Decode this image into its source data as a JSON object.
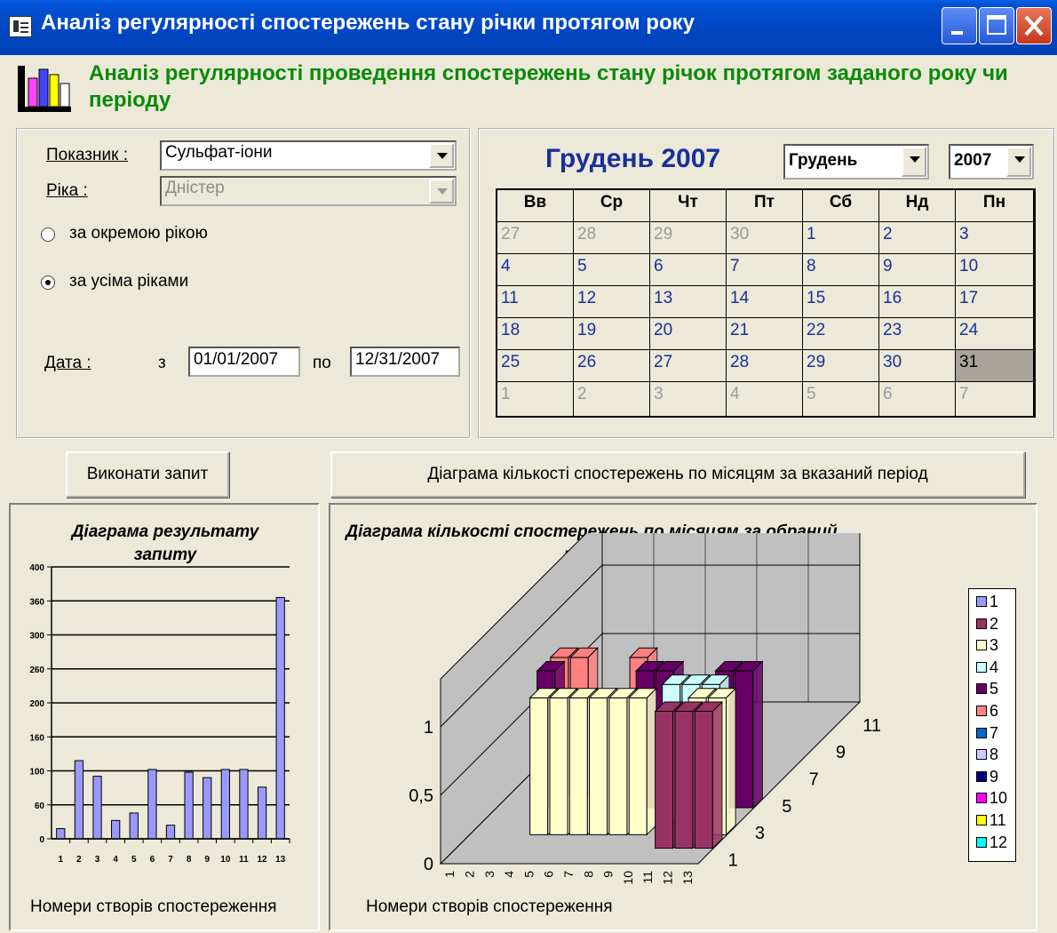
{
  "window": {
    "title": "Аналіз регулярності спостережень стану річки протягом року"
  },
  "header": {
    "text": "Аналіз регулярності проведення спостережень стану річок протягом заданого року чи періоду"
  },
  "filters": {
    "indicator_label": "Показник :",
    "indicator_value": "Сульфат-іони",
    "river_label": "Ріка :",
    "river_value": "Дністер",
    "radio_single": "за окремою рікою",
    "radio_all": "за усіма ріками",
    "radio_selected": "all",
    "date_label": "Дата :",
    "date_from_label": "з",
    "date_from": "01/01/2007",
    "date_to_label": "по",
    "date_to": "12/31/2007"
  },
  "calendar": {
    "title": "Грудень 2007",
    "month_value": "Грудень",
    "year_value": "2007",
    "weekdays": [
      "Вв",
      "Ср",
      "Чт",
      "Пт",
      "Сб",
      "Нд",
      "Пн"
    ],
    "weeks": [
      [
        "27",
        "28",
        "29",
        "30",
        "1",
        "2",
        "3"
      ],
      [
        "4",
        "5",
        "6",
        "7",
        "8",
        "9",
        "10"
      ],
      [
        "11",
        "12",
        "13",
        "14",
        "15",
        "16",
        "17"
      ],
      [
        "18",
        "19",
        "20",
        "21",
        "22",
        "23",
        "24"
      ],
      [
        "25",
        "26",
        "27",
        "28",
        "29",
        "30",
        "31"
      ],
      [
        "1",
        "2",
        "3",
        "4",
        "5",
        "6",
        "7"
      ]
    ],
    "selected_day": "31"
  },
  "buttons": {
    "run_query": "Виконати запит",
    "monthly_chart": "Діаграма кількості спостережень по місяцям за вказаний період"
  },
  "chart_data": [
    {
      "type": "bar",
      "title": "Діаграма результату запиту",
      "xlabel": "Номери створів спостереження",
      "ylabel": "",
      "categories": [
        "1",
        "2",
        "3",
        "4",
        "5",
        "6",
        "7",
        "8",
        "9",
        "10",
        "11",
        "12",
        "13"
      ],
      "values": [
        15,
        115,
        92,
        27,
        38,
        102,
        20,
        98,
        90,
        102,
        102,
        76,
        355
      ],
      "ylim": [
        0,
        400
      ],
      "yticks": [
        0,
        50,
        100,
        150,
        200,
        250,
        300,
        350,
        400
      ],
      "ytick_labels": [
        "0",
        "60",
        "100",
        "160",
        "200",
        "260",
        "300",
        "360",
        "400"
      ],
      "grid": true,
      "bar_color": "#9999ff"
    },
    {
      "type": "bar",
      "title": "Діаграма кількості спостережень по місяцям за обраний період",
      "xlabel": "Номери створів спостереження",
      "categories": [
        "1",
        "2",
        "3",
        "4",
        "5",
        "6",
        "7",
        "8",
        "9",
        "10",
        "11",
        "12",
        "13"
      ],
      "depth_labels": [
        "1",
        "3",
        "5",
        "7",
        "9",
        "11"
      ],
      "yticks": [
        "0",
        "0,5",
        "1"
      ],
      "ylim": [
        0,
        1
      ],
      "series": [
        {
          "name": "1",
          "color": "#9999ff"
        },
        {
          "name": "2",
          "color": "#993366"
        },
        {
          "name": "3",
          "color": "#ffffcc"
        },
        {
          "name": "4",
          "color": "#ccffff"
        },
        {
          "name": "5",
          "color": "#660066"
        },
        {
          "name": "6",
          "color": "#ff8080"
        },
        {
          "name": "7",
          "color": "#0066cc"
        },
        {
          "name": "8",
          "color": "#ccccff"
        },
        {
          "name": "9",
          "color": "#000080"
        },
        {
          "name": "10",
          "color": "#ff00ff"
        },
        {
          "name": "11",
          "color": "#ffff00"
        },
        {
          "name": "12",
          "color": "#00ffff"
        }
      ],
      "points": [
        {
          "series": 6,
          "category": 3,
          "value": 1
        },
        {
          "series": 6,
          "category": 4,
          "value": 1
        },
        {
          "series": 5,
          "category": 3,
          "value": 1
        },
        {
          "series": 3,
          "category": 4,
          "value": 1
        },
        {
          "series": 3,
          "category": 5,
          "value": 1
        },
        {
          "series": 3,
          "category": 6,
          "value": 1
        },
        {
          "series": 3,
          "category": 7,
          "value": 1
        },
        {
          "series": 3,
          "category": 8,
          "value": 1
        },
        {
          "series": 3,
          "category": 9,
          "value": 1
        },
        {
          "series": 3,
          "category": 12,
          "value": 1
        },
        {
          "series": 3,
          "category": 13,
          "value": 1
        },
        {
          "series": 6,
          "category": 7,
          "value": 1
        },
        {
          "series": 5,
          "category": 8,
          "value": 1
        },
        {
          "series": 5,
          "category": 9,
          "value": 1
        },
        {
          "series": 4,
          "category": 10,
          "value": 1
        },
        {
          "series": 4,
          "category": 11,
          "value": 1
        },
        {
          "series": 4,
          "category": 12,
          "value": 1
        },
        {
          "series": 2,
          "category": 11,
          "value": 1
        },
        {
          "series": 2,
          "category": 12,
          "value": 1
        },
        {
          "series": 2,
          "category": 13,
          "value": 1
        },
        {
          "series": 5,
          "category": 12,
          "value": 1
        },
        {
          "series": 5,
          "category": 13,
          "value": 1
        }
      ]
    }
  ]
}
